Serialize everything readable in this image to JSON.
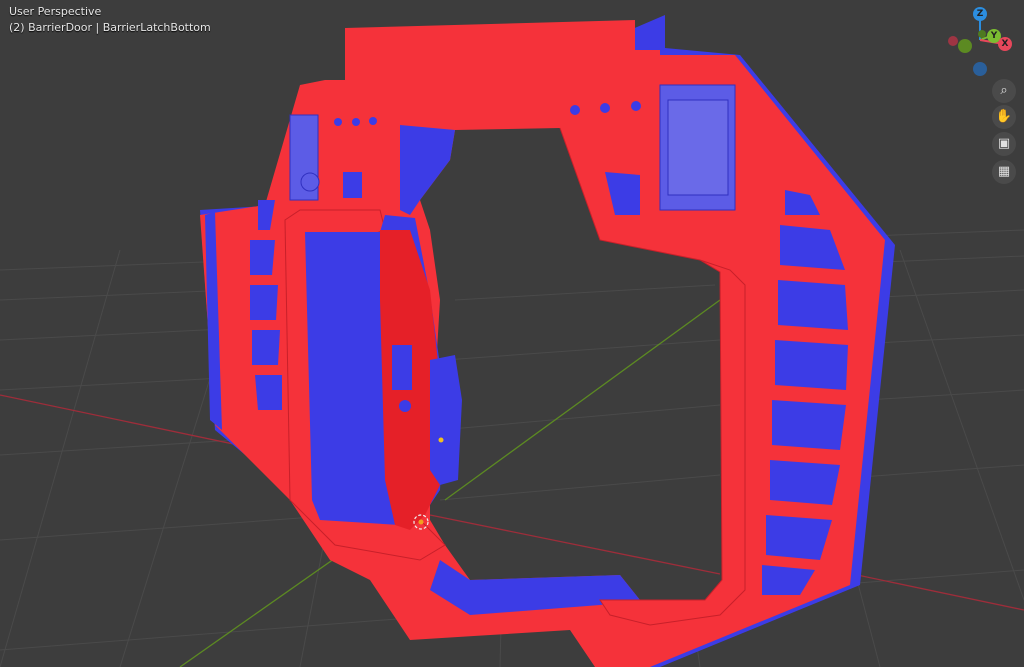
{
  "viewport": {
    "title": "User Perspective",
    "object_info": "(2) BarrierDoor | BarrierLatchBottom"
  },
  "gizmo": {
    "z_label": "Z",
    "y_label": "Y",
    "x_label": "X",
    "colors": {
      "x": "#e8475b",
      "y": "#7bbd31",
      "z": "#2c8ee0"
    }
  },
  "nav_buttons": [
    {
      "icon": "zoom-icon",
      "glyph": "⌕"
    },
    {
      "icon": "hand-pan-icon",
      "glyph": "✋"
    },
    {
      "icon": "camera-icon",
      "glyph": "▣"
    },
    {
      "icon": "grid-ortho-icon",
      "glyph": "▦"
    }
  ],
  "colors": {
    "background": "#3d3d3d",
    "grid": "#4a4a4a",
    "axis_x": "#9e2d3a",
    "axis_y": "#5c8a22",
    "mesh_red": "#f5323a",
    "mesh_blue": "#3c3ce6"
  }
}
